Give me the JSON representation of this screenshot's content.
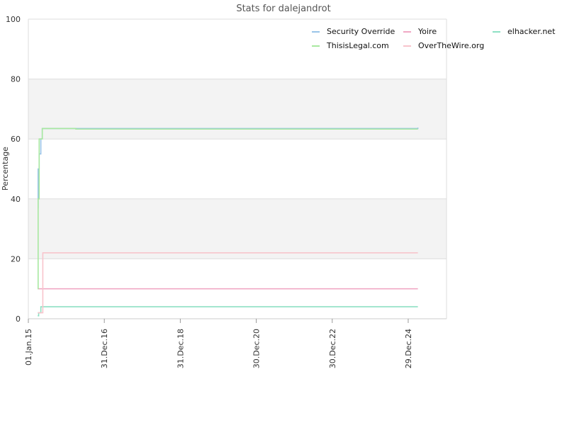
{
  "chart_data": {
    "type": "line",
    "title": "Stats for dalejandrot",
    "ylabel": "Percentage",
    "xlabel": "",
    "ylim": [
      0,
      100
    ],
    "y_ticks": [
      0,
      20,
      40,
      60,
      80,
      100
    ],
    "x_range": [
      "2015-01-01",
      "2026-01-01"
    ],
    "x_ticks": [
      {
        "label": "01.Jan.15",
        "date": "2015-01-01"
      },
      {
        "label": "31.Dec.16",
        "date": "2016-12-31"
      },
      {
        "label": "31.Dec.18",
        "date": "2018-12-31"
      },
      {
        "label": "30.Dec.20",
        "date": "2020-12-30"
      },
      {
        "label": "30.Dec.22",
        "date": "2022-12-30"
      },
      {
        "label": "29.Dec.24",
        "date": "2024-12-29"
      }
    ],
    "grid": true,
    "alternating_bands": true,
    "legend_position": "top-right",
    "series": [
      {
        "name": "Security Override",
        "color": "#99c4e8",
        "points": [
          [
            "2015-04-01",
            37
          ],
          [
            "2015-04-05",
            50
          ],
          [
            "2015-04-15",
            55
          ],
          [
            "2015-05-01",
            60
          ],
          [
            "2015-05-15",
            63.5
          ],
          [
            "2025-04-01",
            63.8
          ]
        ]
      },
      {
        "name": "Yoire",
        "color": "#f0a8c4",
        "points": [
          [
            "2015-04-01",
            10
          ],
          [
            "2025-04-01",
            10
          ]
        ]
      },
      {
        "name": "elhacker.net",
        "color": "#8ee0c4",
        "points": [
          [
            "2015-04-01",
            1
          ],
          [
            "2015-04-10",
            2
          ],
          [
            "2015-05-01",
            4
          ],
          [
            "2025-04-01",
            4
          ]
        ]
      },
      {
        "name": "ThisisLegal.com",
        "color": "#a8e8a0",
        "points": [
          [
            "2015-04-01",
            10
          ],
          [
            "2015-04-05",
            40
          ],
          [
            "2015-04-15",
            60
          ],
          [
            "2015-05-15",
            63.5
          ],
          [
            "2016-04-01",
            63.3
          ],
          [
            "2025-04-01",
            63.3
          ]
        ]
      },
      {
        "name": "OverTheWire.org",
        "color": "#f8c4cc",
        "points": [
          [
            "2015-04-01",
            2
          ],
          [
            "2015-05-10",
            2
          ],
          [
            "2015-05-20",
            22
          ],
          [
            "2025-04-01",
            22
          ]
        ]
      }
    ]
  }
}
